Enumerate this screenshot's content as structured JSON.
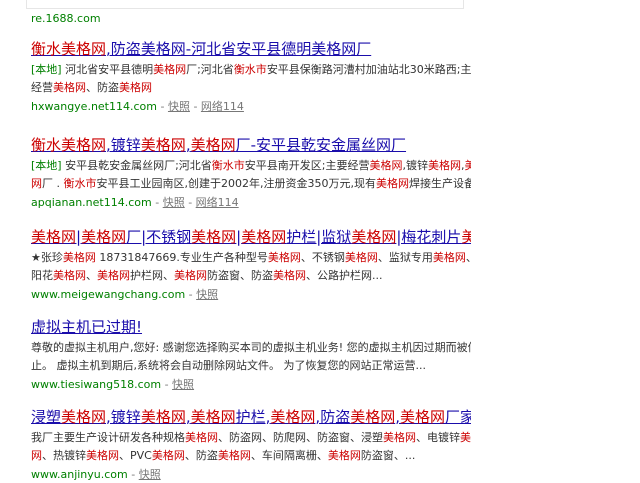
{
  "top": {
    "fragment": "...",
    "url": "re.1688.com"
  },
  "results": [
    {
      "title": [
        {
          "t": "衡水美格网",
          "hl": true
        },
        {
          "t": ",防盗美格网-河北省安平县德明美格网厂",
          "hl": false
        }
      ],
      "snippet_lines": [
        [
          {
            "t": "[本地]",
            "tag": true
          },
          {
            "t": " 河北省安平县德明"
          },
          {
            "t": "美格网",
            "hl": true
          },
          {
            "t": "厂;河北省"
          },
          {
            "t": "衡水市",
            "hl": true
          },
          {
            "t": "安平县保衡路河漕村加油站北30米路西;主要"
          }
        ],
        [
          {
            "t": "经营"
          },
          {
            "t": "美格网",
            "hl": true
          },
          {
            "t": "、防盗"
          },
          {
            "t": "美格网",
            "hl": true
          }
        ]
      ],
      "url": "hxwangye.net114.com",
      "links": [
        "快照",
        "网络114"
      ]
    },
    {
      "title": [
        {
          "t": "衡水美格网",
          "hl": true
        },
        {
          "t": ",镀锌",
          "hl": false
        },
        {
          "t": "美格网",
          "hl": true
        },
        {
          "t": ",",
          "hl": false
        },
        {
          "t": "美格网",
          "hl": true
        },
        {
          "t": "厂-安平县乾安金属丝网厂",
          "hl": false
        }
      ],
      "snippet_lines": [
        [
          {
            "t": "[本地]",
            "tag": true
          },
          {
            "t": " 安平县乾安金属丝网厂;河北省"
          },
          {
            "t": "衡水市",
            "hl": true
          },
          {
            "t": "安平县南开发区;主要经营"
          },
          {
            "t": "美格网",
            "hl": true
          },
          {
            "t": ",镀锌"
          },
          {
            "t": "美格网",
            "hl": true
          },
          {
            "t": ","
          },
          {
            "t": "美格",
            "hl": true
          }
        ],
        [
          {
            "t": "网",
            "hl": true
          },
          {
            "t": "厂 . "
          },
          {
            "t": "衡水市",
            "hl": true
          },
          {
            "t": "安平县工业园南区,创建于2002年,注册资金350万元,现有"
          },
          {
            "t": "美格网",
            "hl": true
          },
          {
            "t": "焊接生产设备..."
          }
        ]
      ],
      "url": "apqianan.net114.com",
      "links": [
        "快照",
        "网络114"
      ]
    },
    {
      "title": [
        {
          "t": "美格网",
          "hl": true
        },
        {
          "t": "|",
          "hl": false
        },
        {
          "t": "美格网",
          "hl": true
        },
        {
          "t": "厂|不锈钢",
          "hl": false
        },
        {
          "t": "美格网",
          "hl": true
        },
        {
          "t": "|",
          "hl": false
        },
        {
          "t": "美格网",
          "hl": true
        },
        {
          "t": "护栏|监狱",
          "hl": false
        },
        {
          "t": "美格网",
          "hl": true
        },
        {
          "t": "|梅花刺片",
          "hl": false
        },
        {
          "t": "美格",
          "hl": true
        },
        {
          "t": "...",
          "hl": false
        }
      ],
      "snippet_lines": [
        [
          {
            "t": "★张珍"
          },
          {
            "t": "美格网",
            "hl": true
          },
          {
            "t": " 18731847669.专业生产各种型号"
          },
          {
            "t": "美格网",
            "hl": true
          },
          {
            "t": "、不锈钢"
          },
          {
            "t": "美格网",
            "hl": true
          },
          {
            "t": "、监狱专用"
          },
          {
            "t": "美格网",
            "hl": true
          },
          {
            "t": "、太"
          }
        ],
        [
          {
            "t": "阳花"
          },
          {
            "t": "美格网",
            "hl": true
          },
          {
            "t": "、"
          },
          {
            "t": "美格网",
            "hl": true
          },
          {
            "t": "护栏网、"
          },
          {
            "t": "美格网",
            "hl": true
          },
          {
            "t": "防盗窗、防盗"
          },
          {
            "t": "美格网",
            "hl": true
          },
          {
            "t": "、公路护栏网..."
          }
        ]
      ],
      "url": "www.meigewangchang.com",
      "links": [
        "快照"
      ]
    },
    {
      "title": [
        {
          "t": "虚拟主机已过期!",
          "hl": false
        }
      ],
      "snippet_lines": [
        [
          {
            "t": "尊敬的虚拟主机用户,您好: 感谢您选择购买本司的虚拟主机业务! 您的虚拟主机因过期而被停"
          }
        ],
        [
          {
            "t": "止。 虚拟主机到期后,系统将会自动删除网站文件。 为了恢复您的网站正常运营..."
          }
        ]
      ],
      "url": "www.tiesiwang518.com",
      "links": [
        "快照"
      ]
    },
    {
      "title": [
        {
          "t": "浸塑",
          "hl": false
        },
        {
          "t": "美格网",
          "hl": true
        },
        {
          "t": ",镀锌",
          "hl": false
        },
        {
          "t": "美格网",
          "hl": true
        },
        {
          "t": ",",
          "hl": false
        },
        {
          "t": "美格网",
          "hl": true
        },
        {
          "t": "护栏,",
          "hl": false
        },
        {
          "t": "美格网",
          "hl": true
        },
        {
          "t": ",防盗",
          "hl": false
        },
        {
          "t": "美格网",
          "hl": true
        },
        {
          "t": ",",
          "hl": false
        },
        {
          "t": "美格网",
          "hl": true
        },
        {
          "t": "厂家,...",
          "hl": false
        }
      ],
      "snippet_lines": [
        [
          {
            "t": "我厂主要生产设计研发各种规格"
          },
          {
            "t": "美格网",
            "hl": true
          },
          {
            "t": "、防盗网、防爬网、防盗窗、浸塑"
          },
          {
            "t": "美格网",
            "hl": true
          },
          {
            "t": "、电镀锌"
          },
          {
            "t": "美格",
            "hl": true
          }
        ],
        [
          {
            "t": "网",
            "hl": true
          },
          {
            "t": "、热镀锌"
          },
          {
            "t": "美格网",
            "hl": true
          },
          {
            "t": "、PVC"
          },
          {
            "t": "美格网",
            "hl": true
          },
          {
            "t": "、防盗"
          },
          {
            "t": "美格网",
            "hl": true
          },
          {
            "t": "、车间隔离栅、"
          },
          {
            "t": "美格网",
            "hl": true
          },
          {
            "t": "防盗窗、..."
          }
        ]
      ],
      "url": "www.anjinyu.com",
      "links": [
        "快照"
      ]
    }
  ]
}
